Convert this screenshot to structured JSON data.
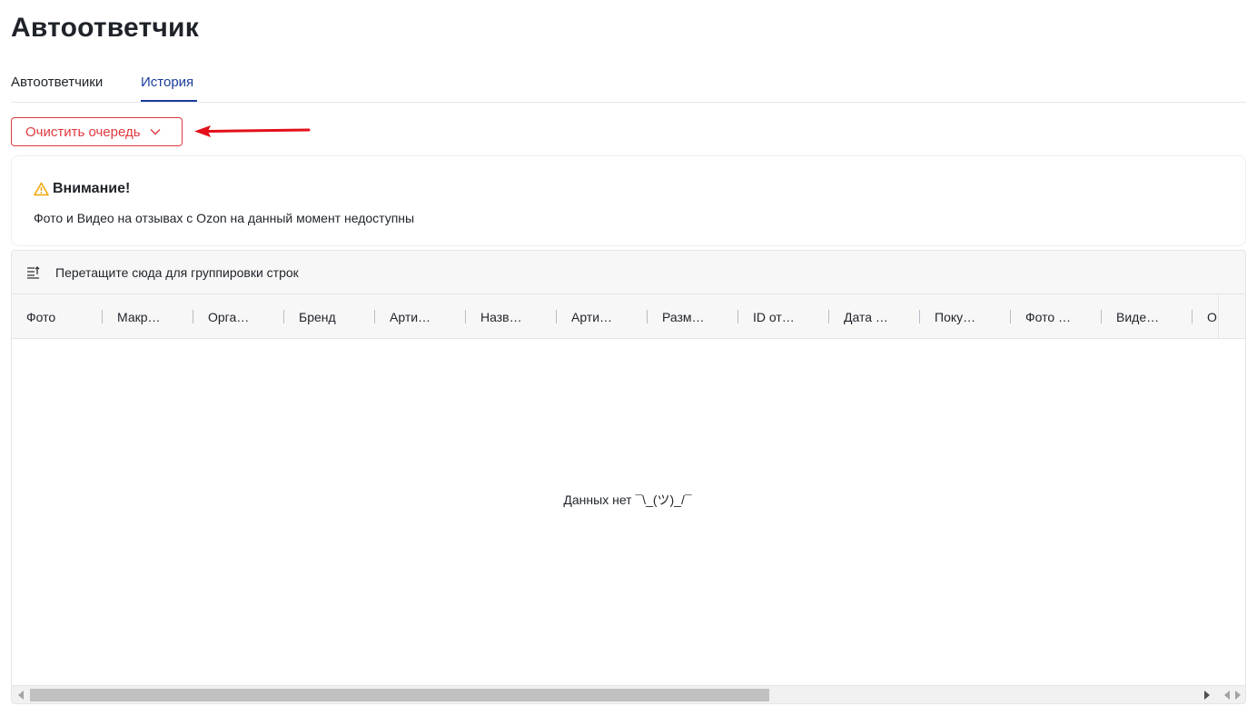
{
  "page": {
    "title": "Автоответчик"
  },
  "tabs": [
    {
      "label": "Автоответчики",
      "active": false
    },
    {
      "label": "История",
      "active": true
    }
  ],
  "actions": {
    "clear_queue_label": "Очистить очередь",
    "danger_color": "#e0393e"
  },
  "annotation": {
    "arrow_color": "#e3101a"
  },
  "notice": {
    "icon": "warning-icon",
    "title": "Внимание!",
    "text": "Фото и Видео на отзывах с Ozon на данный момент недоступны",
    "icon_color": "#f0a500"
  },
  "grid": {
    "group_panel_text": "Перетащите сюда для группировки строк",
    "columns": [
      "Фото",
      "Макр…",
      "Орга…",
      "Бренд",
      "Арти…",
      "Назв…",
      "Арти…",
      "Разм…",
      "ID от…",
      "Дата …",
      "Поку…",
      "Фото …",
      "Виде…",
      "О"
    ],
    "empty_text": "Данных нет ¯\\_(ツ)_/¯"
  },
  "accent_color": "#1a3d9c"
}
